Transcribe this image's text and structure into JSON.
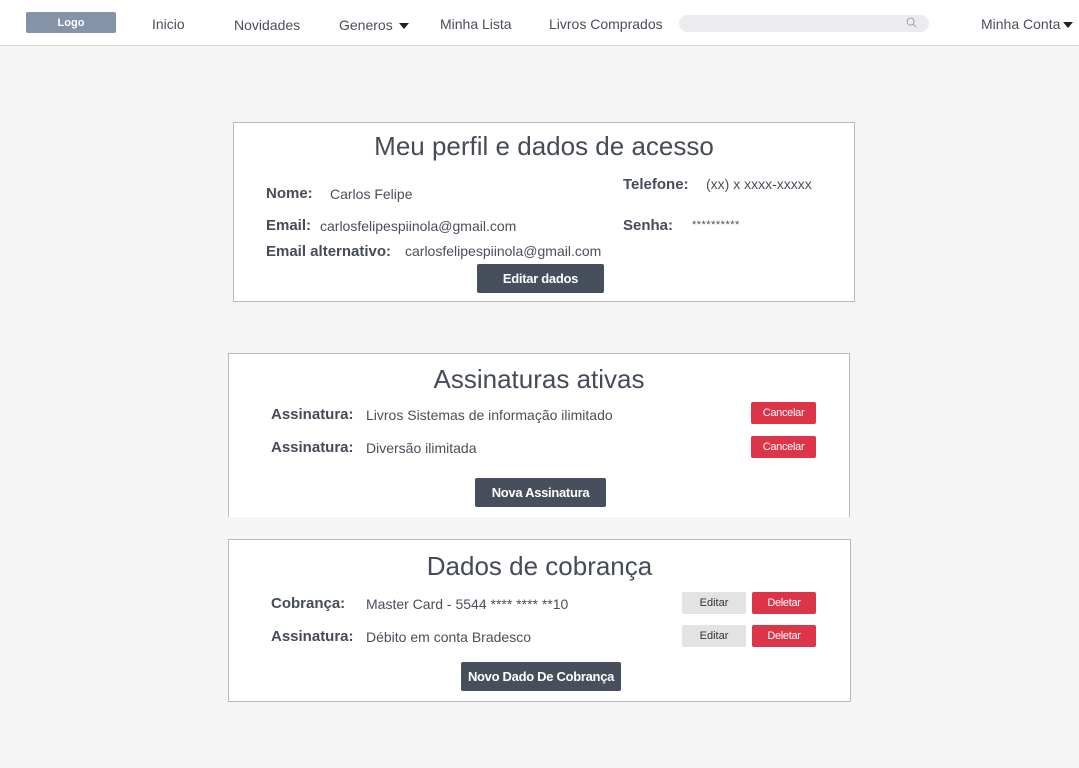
{
  "nav": {
    "logo": "Logo",
    "items": [
      "Inicio",
      "Novidades",
      "Generos",
      "Minha Lista",
      "Livros Comprados"
    ],
    "account": "Minha Conta"
  },
  "profile": {
    "title": "Meu perfil e dados de acesso",
    "name_label": "Nome:",
    "name_value": "Carlos Felipe",
    "email_label": "Email:",
    "email_value": "carlosfelipespiinola@gmail.com",
    "alt_email_label": "Email alternativo:",
    "alt_email_value": "carlosfelipespiinola@gmail.com",
    "phone_label": "Telefone:",
    "phone_value": "(xx) x xxxx-xxxxx",
    "password_label": "Senha:",
    "password_value": "**********",
    "edit_button": "Editar dados"
  },
  "subscriptions": {
    "title": "Assinaturas ativas",
    "items": [
      {
        "label": "Assinatura:",
        "value": "Livros Sistemas de informação ilimitado",
        "cancel": "Cancelar"
      },
      {
        "label": "Assinatura:",
        "value": "Diversão ilimitada",
        "cancel": "Cancelar"
      }
    ],
    "new_button": "Nova Assinatura"
  },
  "billing": {
    "title": "Dados de cobrança",
    "items": [
      {
        "label": "Cobrança:",
        "value": "Master Card - 5544 **** **** **10",
        "edit": "Editar",
        "delete": "Deletar"
      },
      {
        "label": "Assinatura:",
        "value": "Débito em conta Bradesco",
        "edit": "Editar",
        "delete": "Deletar"
      }
    ],
    "new_button": "Novo Dado  De Cobrança"
  },
  "colors": {
    "primary_button": "#474f5c",
    "danger_button": "#dc3547",
    "logo_bg": "#8593a8",
    "background": "#f5f5f6"
  }
}
